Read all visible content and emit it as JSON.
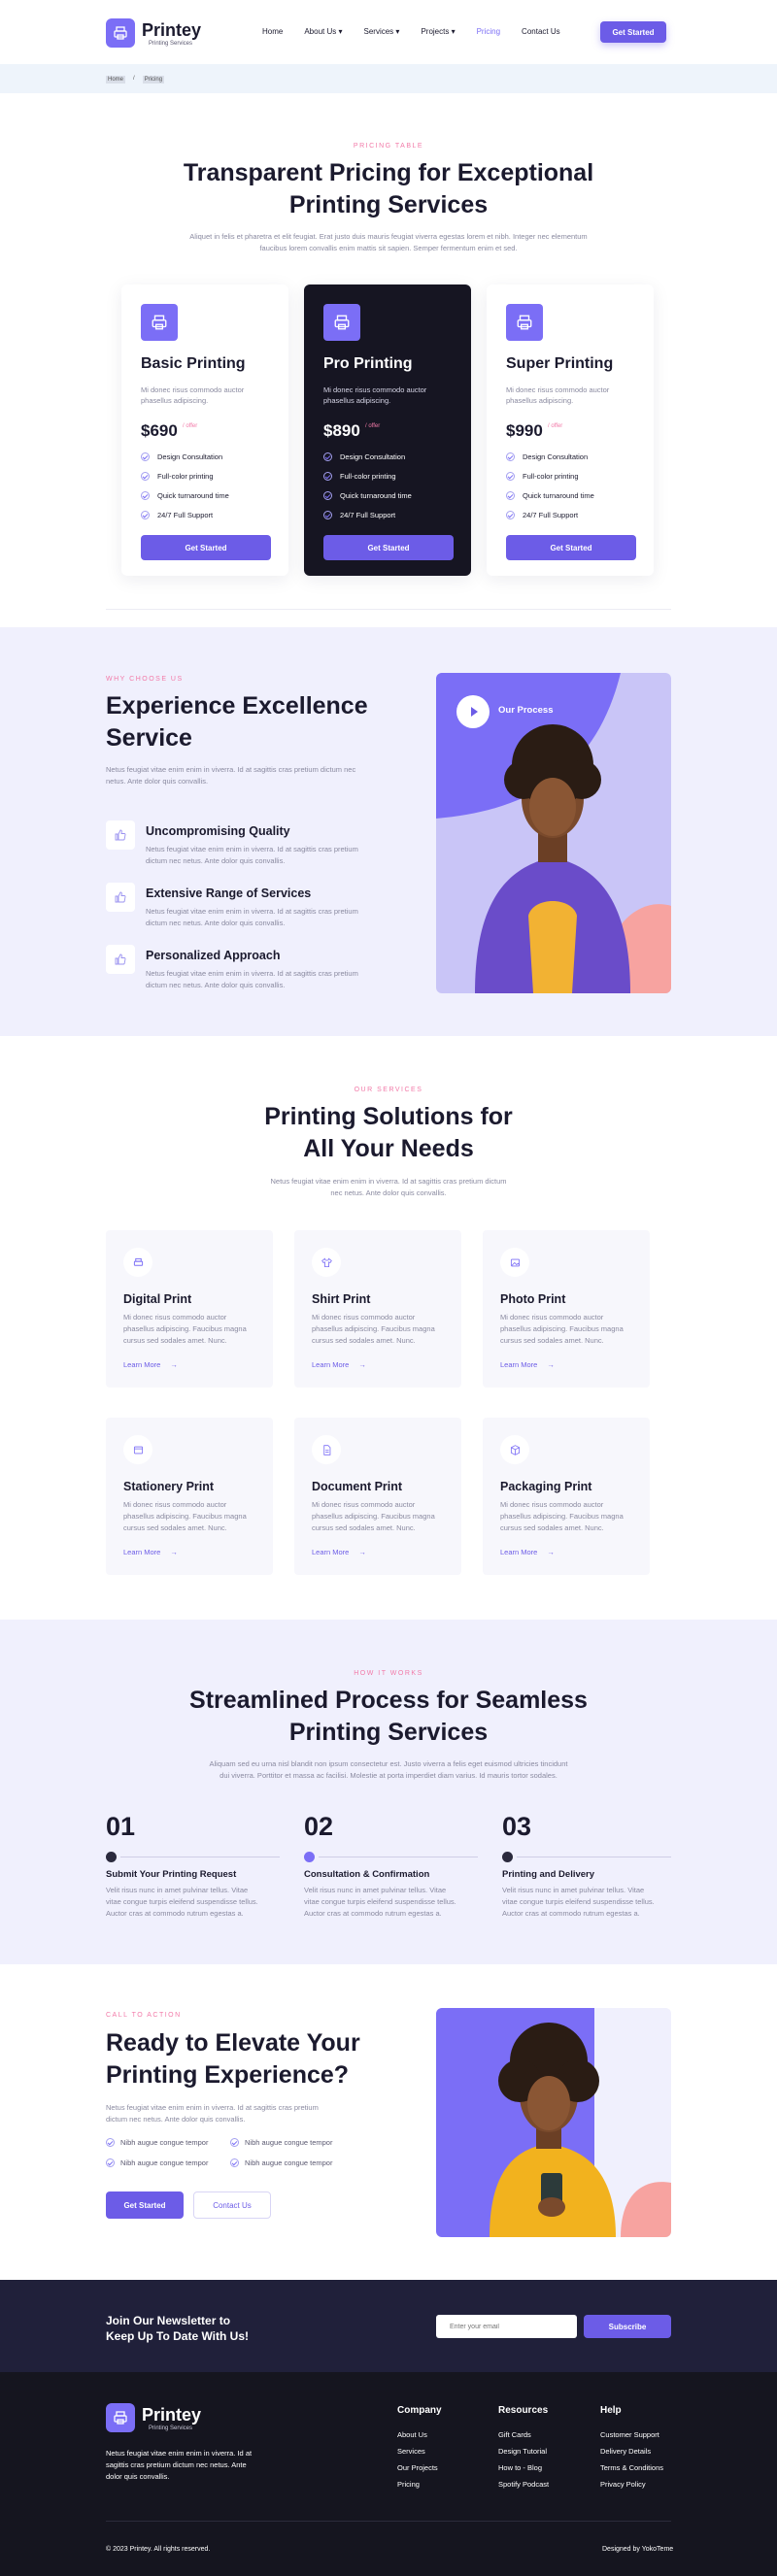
{
  "brand": {
    "name": "Printey",
    "tagline": "Printing Services",
    "accent": "#7b6ef6",
    "pink": "#f27aa8",
    "dark": "#161522"
  },
  "nav": {
    "items": [
      "Home",
      "About Us",
      "Services",
      "Projects",
      "Pricing",
      "Contact Us"
    ],
    "cta": "Get Started"
  },
  "breadcrumb": [
    "Home",
    "Pricing"
  ],
  "pricing": {
    "eyebrow": "Pricing Table",
    "title_1": "Transparent Pricing for Exceptional",
    "title_2": "Printing Services",
    "desc_1": "Aliquet in felis et pharetra et elit feugiat. Erat justo duis mauris feugiat viverra egestas lorem et nibh. Integer nec elementum",
    "desc_2": "faucibus lorem convallis enim mattis sit sapien. Semper fermentum enim et sed.",
    "plans": [
      {
        "name": "Basic Printing",
        "desc_1": "Mi donec risus commodo auctor",
        "desc_2": "phasellus adipiscing.",
        "price": "$690",
        "per": "/ offer",
        "button": "Get Started",
        "features": [
          "Design Consultation",
          "Full-color printing",
          "Quick turnaround time",
          "24/7 Full Support"
        ]
      },
      {
        "name": "Pro Printing",
        "desc_1": "Mi donec risus commodo auctor",
        "desc_2": "phasellus adipiscing.",
        "price": "$890",
        "per": "/ offer",
        "button": "Get Started",
        "features": [
          "Design Consultation",
          "Full-color printing",
          "Quick turnaround time",
          "24/7 Full Support"
        ]
      },
      {
        "name": "Super Printing",
        "desc_1": "Mi donec risus commodo auctor",
        "desc_2": "phasellus adipiscing.",
        "price": "$990",
        "per": "/ offer",
        "button": "Get Started",
        "features": [
          "Design Consultation",
          "Full-color printing",
          "Quick turnaround time",
          "24/7 Full Support"
        ]
      }
    ]
  },
  "why": {
    "eyebrow": "Why Choose Us",
    "title_1": "Experience Excellence",
    "title_2": "Service",
    "desc_1": "Netus feugiat vitae enim enim in viverra. Id at sagittis cras pretium dictum nec",
    "desc_2": "netus. Ante dolor quis convallis.",
    "play": "Our Process",
    "items": [
      {
        "title": "Uncompromising Quality",
        "desc_1": "Netus feugiat vitae enim enim in viverra. Id at sagittis cras pretium",
        "desc_2": "dictum nec netus. Ante dolor quis convallis."
      },
      {
        "title": "Extensive Range of Services",
        "desc_1": "Netus feugiat vitae enim enim in viverra. Id at sagittis cras pretium",
        "desc_2": "dictum nec netus. Ante dolor quis convallis."
      },
      {
        "title": "Personalized Approach",
        "desc_1": "Netus feugiat vitae enim enim in viverra. Id at sagittis cras pretium",
        "desc_2": "dictum nec netus. Ante dolor quis convallis."
      }
    ]
  },
  "services": {
    "eyebrow": "Our Services",
    "title_1": "Printing Solutions for",
    "title_2": "All Your Needs",
    "desc_1": "Netus feugiat vitae enim enim in viverra. Id at sagittis cras pretium dictum",
    "desc_2": "nec netus. Ante dolor quis convallis.",
    "items": [
      {
        "title": "Digital Print",
        "icon": "printer-icon",
        "desc_1": "Mi donec risus commodo auctor",
        "desc_2": "phasellus adipiscing. Faucibus magna",
        "desc_3": "cursus sed sodales amet. Nunc.",
        "link": "Learn More"
      },
      {
        "title": "Shirt Print",
        "icon": "shirt-icon",
        "desc_1": "Mi donec risus commodo auctor",
        "desc_2": "phasellus adipiscing. Faucibus magna",
        "desc_3": "cursus sed sodales amet. Nunc.",
        "link": "Learn More"
      },
      {
        "title": "Photo Print",
        "icon": "photo-icon",
        "desc_1": "Mi donec risus commodo auctor",
        "desc_2": "phasellus adipiscing. Faucibus magna",
        "desc_3": "cursus sed sodales amet. Nunc.",
        "link": "Learn More"
      },
      {
        "title": "Stationery Print",
        "icon": "stationery-icon",
        "desc_1": "Mi donec risus commodo auctor",
        "desc_2": "phasellus adipiscing. Faucibus magna",
        "desc_3": "cursus sed sodales amet. Nunc.",
        "link": "Learn More"
      },
      {
        "title": "Document Print",
        "icon": "document-icon",
        "desc_1": "Mi donec risus commodo auctor",
        "desc_2": "phasellus adipiscing. Faucibus magna",
        "desc_3": "cursus sed sodales amet. Nunc.",
        "link": "Learn More"
      },
      {
        "title": "Packaging Print",
        "icon": "box-icon",
        "desc_1": "Mi donec risus commodo auctor",
        "desc_2": "phasellus adipiscing. Faucibus magna",
        "desc_3": "cursus sed sodales amet. Nunc.",
        "link": "Learn More"
      }
    ]
  },
  "process": {
    "eyebrow": "How It Works",
    "title_1": "Streamlined Process for Seamless",
    "title_2": "Printing Services",
    "desc_1": "Aliquam sed eu urna nisl blandit non ipsum consectetur est. Justo viverra a felis eget euismod ultricies tincidunt",
    "desc_2": "dui viverra. Porttitor et massa ac facilisi. Molestie at porta imperdiet diam varius. Id mauris tortor sodales.",
    "steps": [
      {
        "num": "01",
        "title": "Submit Your Printing Request",
        "desc_1": "Velit risus nunc in amet pulvinar tellus. Vitae",
        "desc_2": "vitae congue turpis eleifend suspendisse tellus.",
        "desc_3": "Auctor cras at commodo rutrum egestas a."
      },
      {
        "num": "02",
        "title": "Consultation & Confirmation",
        "desc_1": "Velit risus nunc in amet pulvinar tellus. Vitae",
        "desc_2": "vitae congue turpis eleifend suspendisse tellus.",
        "desc_3": "Auctor cras at commodo rutrum egestas a."
      },
      {
        "num": "03",
        "title": "Printing and Delivery",
        "desc_1": "Velit risus nunc in amet pulvinar tellus. Vitae",
        "desc_2": "vitae congue turpis eleifend suspendisse tellus.",
        "desc_3": "Auctor cras at commodo rutrum egestas a."
      }
    ]
  },
  "cta": {
    "eyebrow": "Call to Action",
    "title_1": "Ready to Elevate Your",
    "title_2": "Printing Experience?",
    "desc_1": "Netus feugiat vitae enim enim in viverra. Id at sagittis cras pretium",
    "desc_2": "dictum nec netus. Ante dolor quis convallis.",
    "ticks": [
      "Nibh augue congue tempor",
      "Nibh augue congue tempor",
      "Nibh augue congue tempor",
      "Nibh augue congue tempor"
    ],
    "primary": "Get Started",
    "secondary": "Contact Us"
  },
  "newsletter": {
    "title_1": "Join Our Newsletter to",
    "title_2": "Keep Up To Date With Us!",
    "placeholder": "Enter your email",
    "button": "Subscribe"
  },
  "footer": {
    "desc_1": "Netus feugiat vitae enim enim in viverra. Id at",
    "desc_2": "sagittis cras pretium dictum nec netus. Ante",
    "desc_3": "dolor quis convallis.",
    "columns": [
      {
        "title": "Company",
        "links": [
          "About Us",
          "Services",
          "Our Projects",
          "Pricing"
        ]
      },
      {
        "title": "Resources",
        "links": [
          "Gift Cards",
          "Design Tutorial",
          "How to - Blog",
          "Spotify Podcast"
        ]
      },
      {
        "title": "Help",
        "links": [
          "Customer Support",
          "Delivery Details",
          "Terms & Conditions",
          "Privacy Policy"
        ]
      }
    ],
    "copyright": "© 2023 Printey. All rights reserved.",
    "credit": "Designed by YokoTeme"
  }
}
